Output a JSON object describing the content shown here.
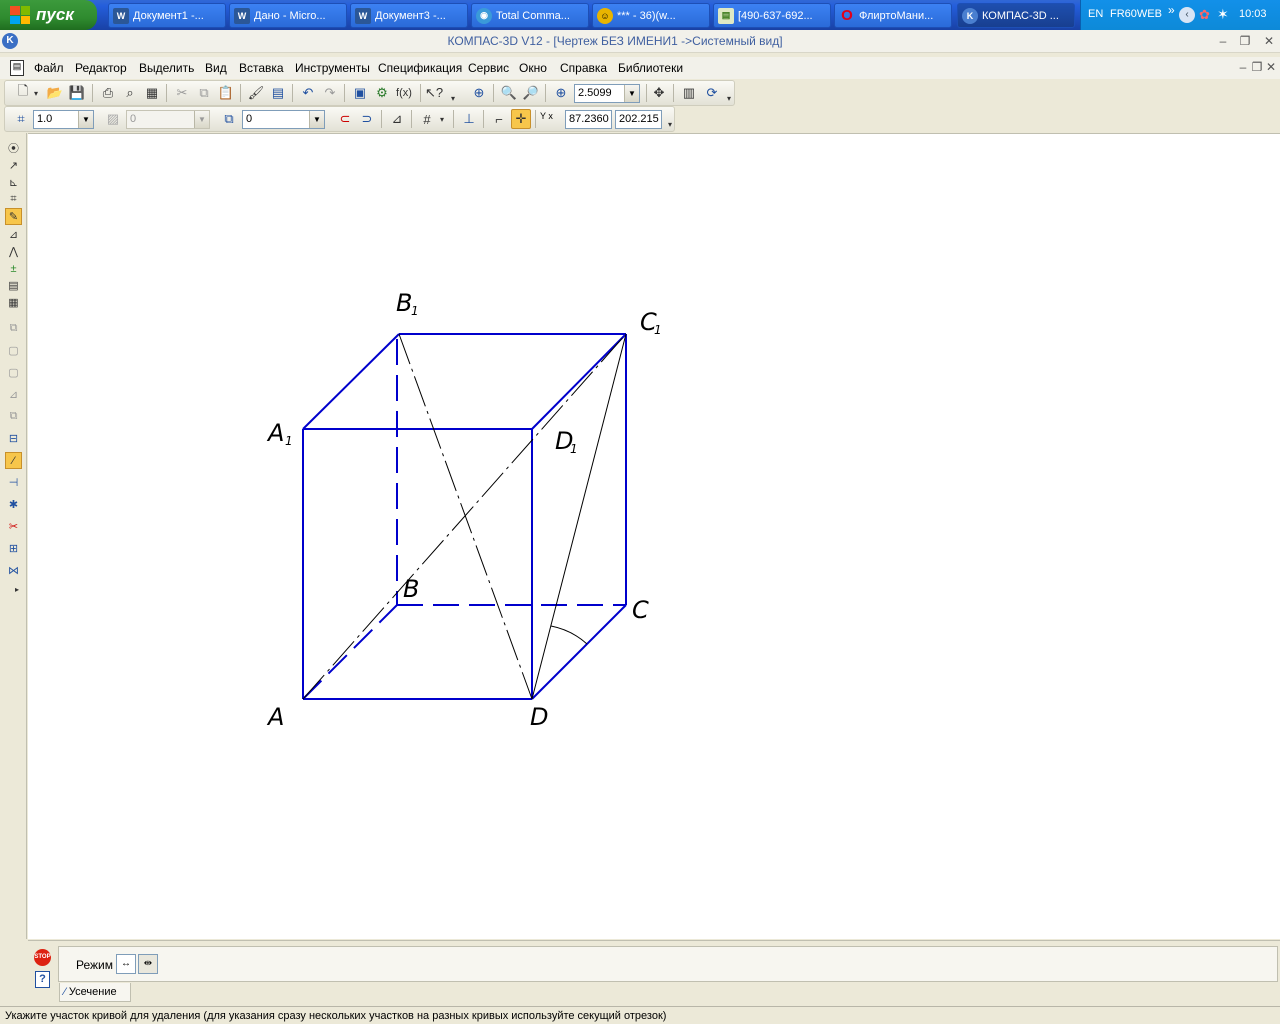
{
  "taskbar": {
    "start_label": "пуск",
    "tasks": [
      {
        "label": "Документ1 -...",
        "icon": "word-icon"
      },
      {
        "label": "Дано - Micro...",
        "icon": "word-icon"
      },
      {
        "label": "Документ3 -...",
        "icon": "word-icon"
      },
      {
        "label": "Total Comma...",
        "icon": "total-commander-icon"
      },
      {
        "label": "*** - 36)(w...",
        "icon": "chat-icon"
      },
      {
        "label": "[490-637-692...",
        "icon": "icq-icon"
      },
      {
        "label": "ФлиртоМани...",
        "icon": "opera-icon"
      },
      {
        "label": "КОМПАС-3D ...",
        "icon": "kompas-icon"
      }
    ],
    "tray": {
      "lang": "EN",
      "label": "FR60WEB",
      "more": "»",
      "time": "10:03"
    }
  },
  "app": {
    "title": "КОМПАС-3D V12 - [Чертеж БЕЗ ИМЕНИ1 ->Системный вид]"
  },
  "menu": [
    "Файл",
    "Редактор",
    "Выделить",
    "Вид",
    "Вставка",
    "Инструменты",
    "Спецификация",
    "Сервис",
    "Окно",
    "Справка",
    "Библиотеки"
  ],
  "toolbar": {
    "zoom_value": "2.5099",
    "fx_label": "f(x)",
    "scale_value": "1.0",
    "style_value": "0",
    "layer_value": "0",
    "coord_x": "87.2360",
    "coord_y": "202.215",
    "coord_axis_label": "Y x"
  },
  "drawing": {
    "labels": {
      "A": "A",
      "B": "B",
      "C": "C",
      "D": "D",
      "A1": "A",
      "B1": "B",
      "C1": "C",
      "D1": "D",
      "subscript": "1"
    },
    "line_color": "#0000cc"
  },
  "panel": {
    "mode_label": "Режим",
    "tab_label": "Усечение"
  },
  "status": {
    "text": "Укажите участок кривой для удаления (для указания сразу нескольких участков на разных кривых используйте секущий отрезок)"
  }
}
